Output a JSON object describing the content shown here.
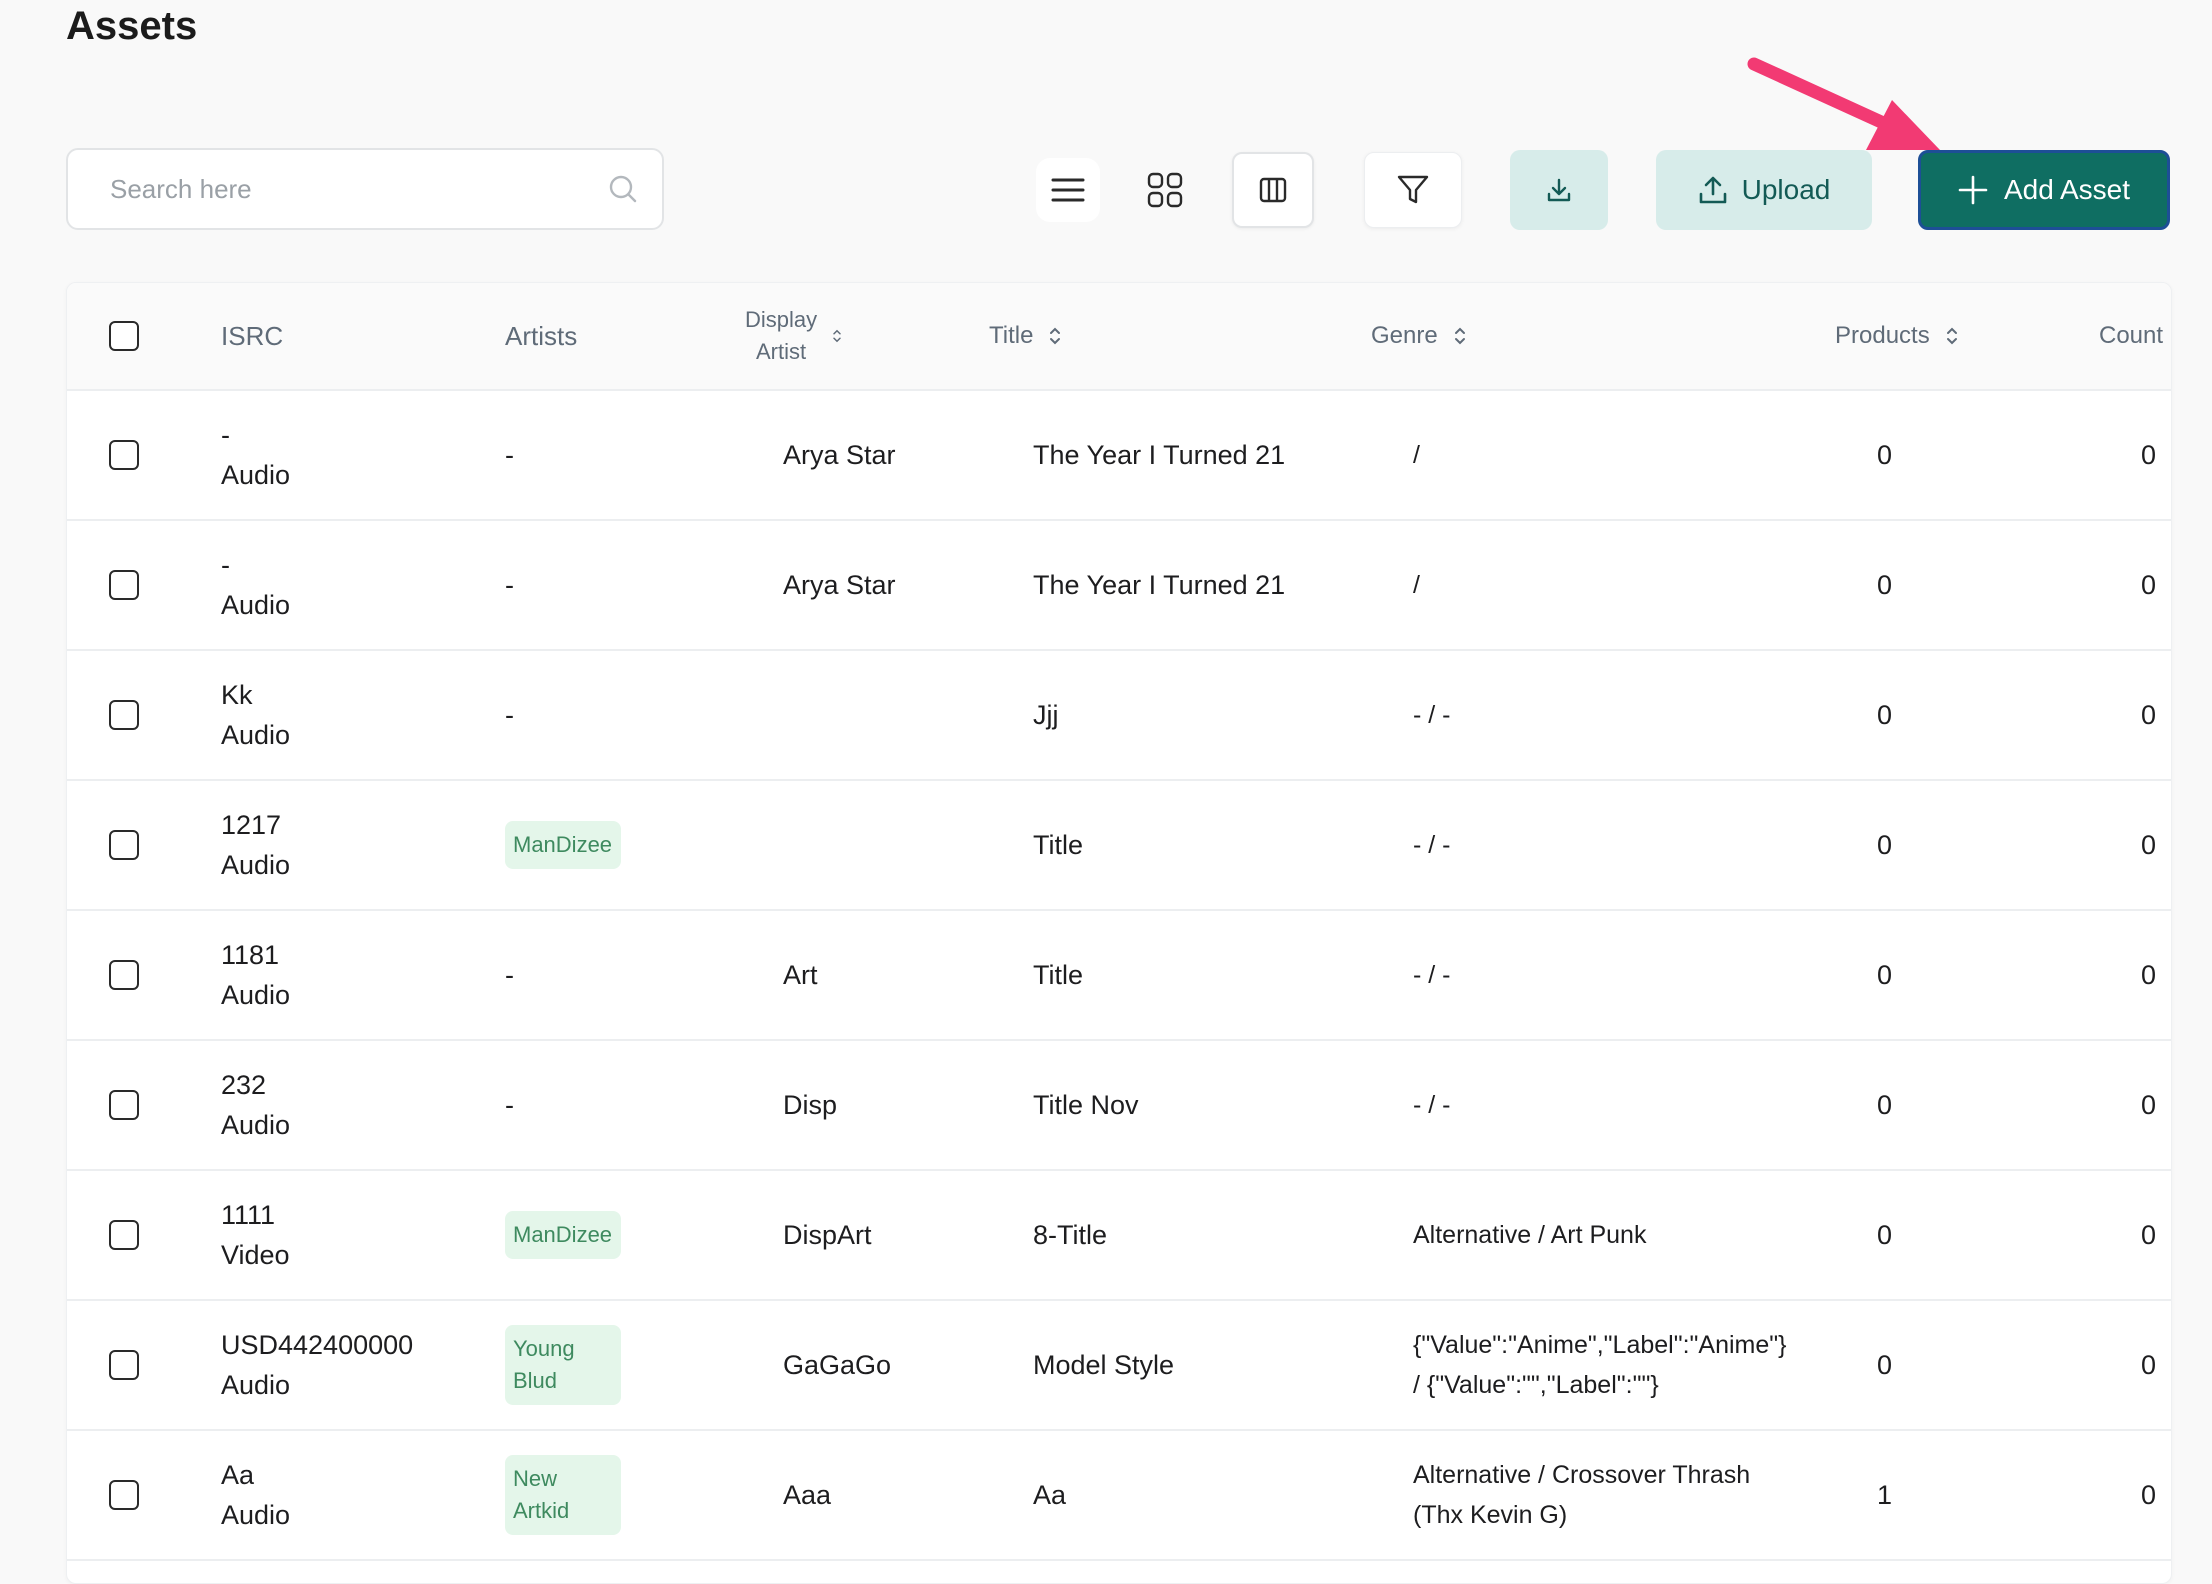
{
  "page": {
    "title": "Assets"
  },
  "search": {
    "placeholder": "Search here"
  },
  "toolbar": {
    "upload_label": "Upload",
    "add_label": "Add Asset"
  },
  "table": {
    "headers": {
      "isrc": "ISRC",
      "artists": "Artists",
      "display_line1": "Display",
      "display_line2": "Artist",
      "title": "Title",
      "genre": "Genre",
      "products": "Products",
      "count": "Count"
    },
    "rows": [
      {
        "isrc": "-",
        "type": "Audio",
        "artists": "-",
        "artist_badge": "",
        "display": "Arya Star",
        "title": "The Year I Turned 21",
        "genre1": "/",
        "genre2": "",
        "products": "0",
        "count": "0"
      },
      {
        "isrc": "-",
        "type": "Audio",
        "artists": "-",
        "artist_badge": "",
        "display": "Arya Star",
        "title": "The Year I Turned 21",
        "genre1": "/",
        "genre2": "",
        "products": "0",
        "count": "0"
      },
      {
        "isrc": "Kk",
        "type": "Audio",
        "artists": "-",
        "artist_badge": "",
        "display": "",
        "title": "Jjj",
        "genre1": "- / -",
        "genre2": "",
        "products": "0",
        "count": "0"
      },
      {
        "isrc": "1217",
        "type": "Audio",
        "artists": "",
        "artist_badge": "ManDizee",
        "display": "",
        "title": "Title",
        "genre1": "- / -",
        "genre2": "",
        "products": "0",
        "count": "0"
      },
      {
        "isrc": "1181",
        "type": "Audio",
        "artists": "-",
        "artist_badge": "",
        "display": "Art",
        "title": "Title",
        "genre1": "- / -",
        "genre2": "",
        "products": "0",
        "count": "0"
      },
      {
        "isrc": "232",
        "type": "Audio",
        "artists": "-",
        "artist_badge": "",
        "display": "Disp",
        "title": "Title Nov",
        "genre1": "- / -",
        "genre2": "",
        "products": "0",
        "count": "0"
      },
      {
        "isrc": "1111",
        "type": "Video",
        "artists": "",
        "artist_badge": "ManDizee",
        "display": "DispArt",
        "title": "8-Title",
        "genre1": "Alternative / Art Punk",
        "genre2": "",
        "products": "0",
        "count": "0"
      },
      {
        "isrc": "USD442400000",
        "type": "Audio",
        "artists": "",
        "artist_badge": "Young Blud",
        "display": "GaGaGo",
        "title": "Model Style",
        "genre1": "{\"Value\":\"Anime\",\"Label\":\"Anime\"}",
        "genre2": "/ {\"Value\":\"\",\"Label\":\"\"}",
        "products": "0",
        "count": "0"
      },
      {
        "isrc": "Aa",
        "type": "Audio",
        "artists": "",
        "artist_badge": "New Artkid",
        "display": "Aaa",
        "title": "Aa",
        "genre1": "Alternative / Crossover Thrash",
        "genre2": "(Thx Kevin G)",
        "products": "1",
        "count": "0"
      }
    ]
  },
  "icons": {
    "search": "search-icon",
    "list": "list-view-icon",
    "grid": "grid-view-icon",
    "columns": "columns-icon",
    "filter": "filter-icon",
    "download": "download-icon",
    "upload": "upload-icon",
    "plus": "plus-icon",
    "sort": "sort-icon",
    "annotation": "arrow-annotation"
  },
  "colors": {
    "primary": "#0f6e62",
    "primary_light": "#d7ecea",
    "badge_bg": "#e4f6ea",
    "badge_text": "#3e8a5f",
    "annotation": "#f23a73"
  }
}
